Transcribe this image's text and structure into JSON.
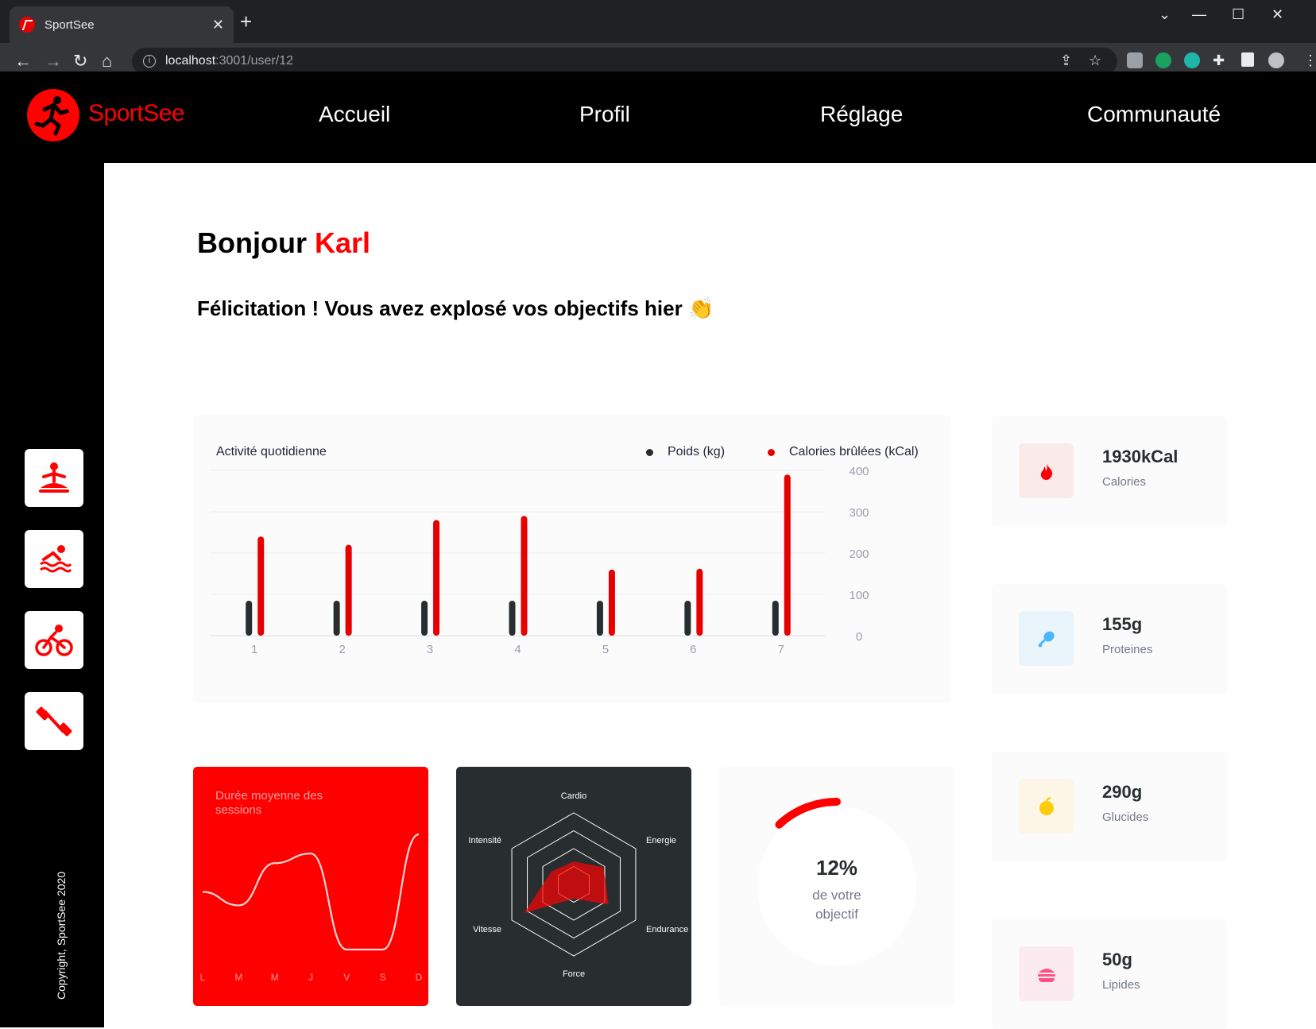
{
  "browser": {
    "tab_title": "SportSee",
    "tab_close": "✕",
    "new_tab": "+",
    "url_host": "localhost",
    "url_path": ":3001/user/12"
  },
  "header": {
    "brand": "SportSee",
    "nav": [
      "Accueil",
      "Profil",
      "Réglage",
      "Communauté"
    ]
  },
  "sidebar": {
    "icons": [
      "yoga-icon",
      "swimming-icon",
      "cycling-icon",
      "dumbbell-icon"
    ],
    "copyright": "Copyright, SportSee 2020"
  },
  "greeting": {
    "hello": "Bonjour",
    "name": "Karl",
    "message": "Félicitation ! Vous avez explosé vos objectifs hier",
    "emoji": "👏"
  },
  "activity": {
    "title": "Activité quotidienne",
    "legend_weight": "Poids (kg)",
    "legend_calories": "Calories brûlées (kCal)",
    "colors": {
      "weight": "#282d30",
      "calories": "#e60000"
    }
  },
  "chart_data": [
    {
      "type": "bar",
      "title": "Activité quotidienne",
      "categories": [
        "1",
        "2",
        "3",
        "4",
        "5",
        "6",
        "7"
      ],
      "yticks": [
        0,
        100,
        200,
        300,
        400
      ],
      "ylim": [
        0,
        400
      ],
      "series": [
        {
          "name": "Poids (kg)",
          "values": [
            80,
            80,
            81,
            81,
            80,
            78,
            76
          ]
        },
        {
          "name": "Calories brûlées (kCal)",
          "values": [
            240,
            220,
            280,
            290,
            160,
            162,
            390
          ]
        }
      ],
      "grid": true,
      "legend": "top-right"
    },
    {
      "type": "line",
      "title": "Durée moyenne des sessions",
      "categories": [
        "L",
        "M",
        "M",
        "J",
        "V",
        "S",
        "D"
      ],
      "values": [
        30,
        23,
        45,
        50,
        0,
        0,
        60
      ]
    },
    {
      "type": "radar",
      "axes": [
        "Cardio",
        "Energie",
        "Endurance",
        "Force",
        "Vitesse",
        "Intensité"
      ],
      "values": [
        80,
        120,
        140,
        50,
        200,
        90
      ],
      "max": 250
    },
    {
      "type": "radial",
      "value": 0.12,
      "label_value": "12%",
      "label_text": "de votre objectif"
    }
  ],
  "sessions": {
    "title": "Durée moyenne des sessions"
  },
  "score": {
    "value": "12%",
    "line1": "de votre",
    "line2": "objectif"
  },
  "keydata": [
    {
      "value": "1930kCal",
      "label": "Calories",
      "icon": "flame-icon",
      "bg": "#fbeaea",
      "color": "#ff0000"
    },
    {
      "value": "155g",
      "label": "Proteines",
      "icon": "chicken-icon",
      "bg": "#e9f4fb",
      "color": "#4ab8ff"
    },
    {
      "value": "290g",
      "label": "Glucides",
      "icon": "apple-icon",
      "bg": "#fbf6e5",
      "color": "#fdcc0c"
    },
    {
      "value": "50g",
      "label": "Lipides",
      "icon": "burger-icon",
      "bg": "#fbeaef",
      "color": "#fd5181"
    }
  ]
}
